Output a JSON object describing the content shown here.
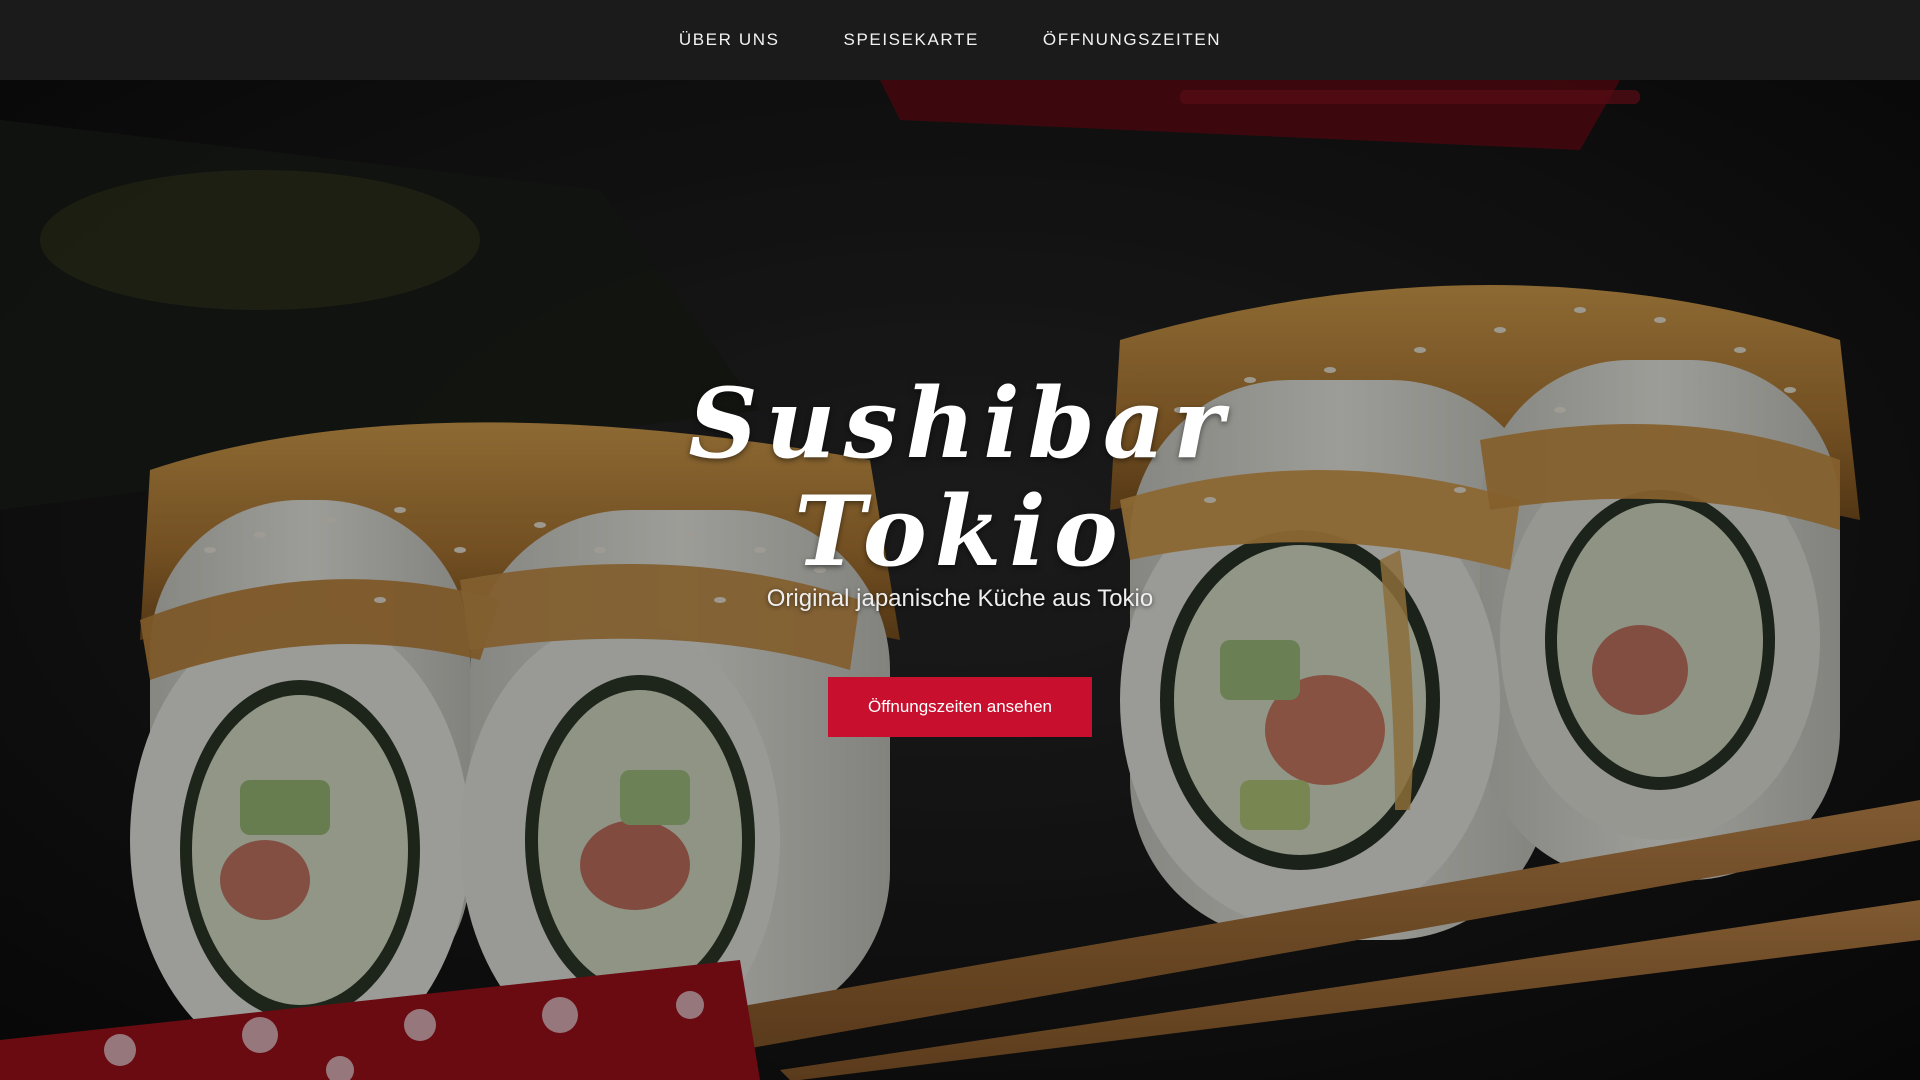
{
  "nav": {
    "items": [
      {
        "label": "ÜBER UNS"
      },
      {
        "label": "SPEISEKARTE"
      },
      {
        "label": "ÖFFNUNGSZEITEN"
      }
    ]
  },
  "hero": {
    "title_line1": "Sushibar",
    "title_line2": "Tokio",
    "subtitle": "Original japanische Küche aus Tokio",
    "cta_label": "Öffnungszeiten ansehen",
    "background_image": "sushi-rolls-with-chopsticks"
  },
  "colors": {
    "nav_background": "#1b1b1b",
    "accent": "#c8102e",
    "text": "#ffffff"
  }
}
